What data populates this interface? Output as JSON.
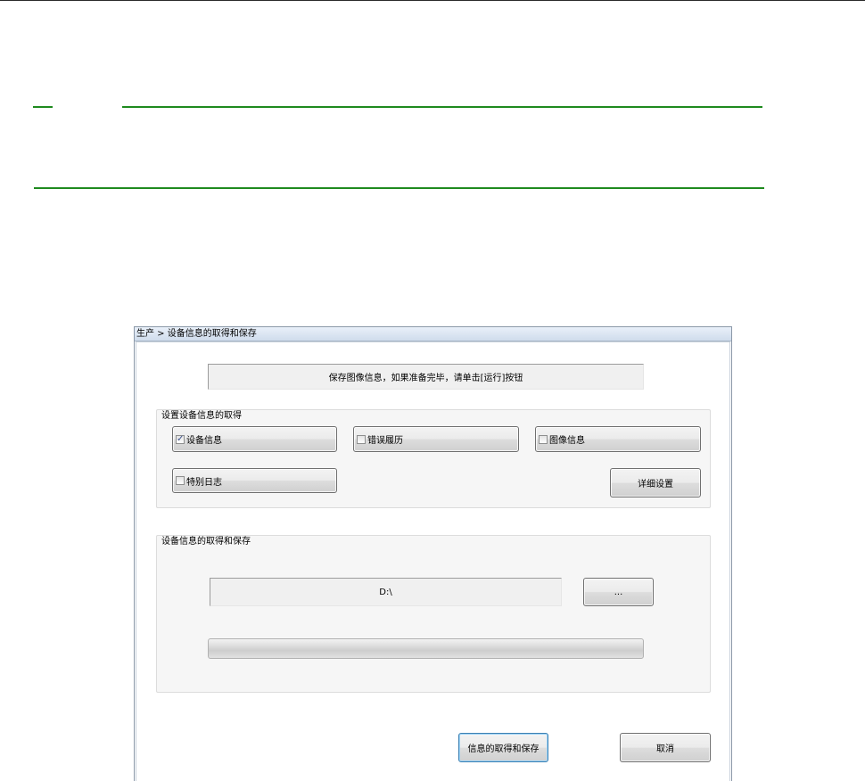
{
  "dialog": {
    "title": "生产 > 设备信息的取得和保存",
    "message": "保存图像信息，如果准备完毕，请单击[运行]按钮",
    "acquire_group": {
      "label": "设置设备信息的取得",
      "options": [
        {
          "label": "设备信息",
          "checked": true
        },
        {
          "label": "错误履历",
          "checked": false
        },
        {
          "label": "图像信息",
          "checked": false
        },
        {
          "label": "特别日志",
          "checked": false
        }
      ],
      "detail_button": "详细设置"
    },
    "save_group": {
      "label": "设备信息的取得和保存",
      "path": "D:\\",
      "browse_button": "...",
      "progress_percent": 0
    },
    "buttons": {
      "run": "信息的取得和保存",
      "cancel": "取消"
    }
  },
  "colors": {
    "divider": "#1e8a1e",
    "default_button_border": "#3c7fb1"
  },
  "icons": {
    "checkbox": "checkbox-icon"
  }
}
